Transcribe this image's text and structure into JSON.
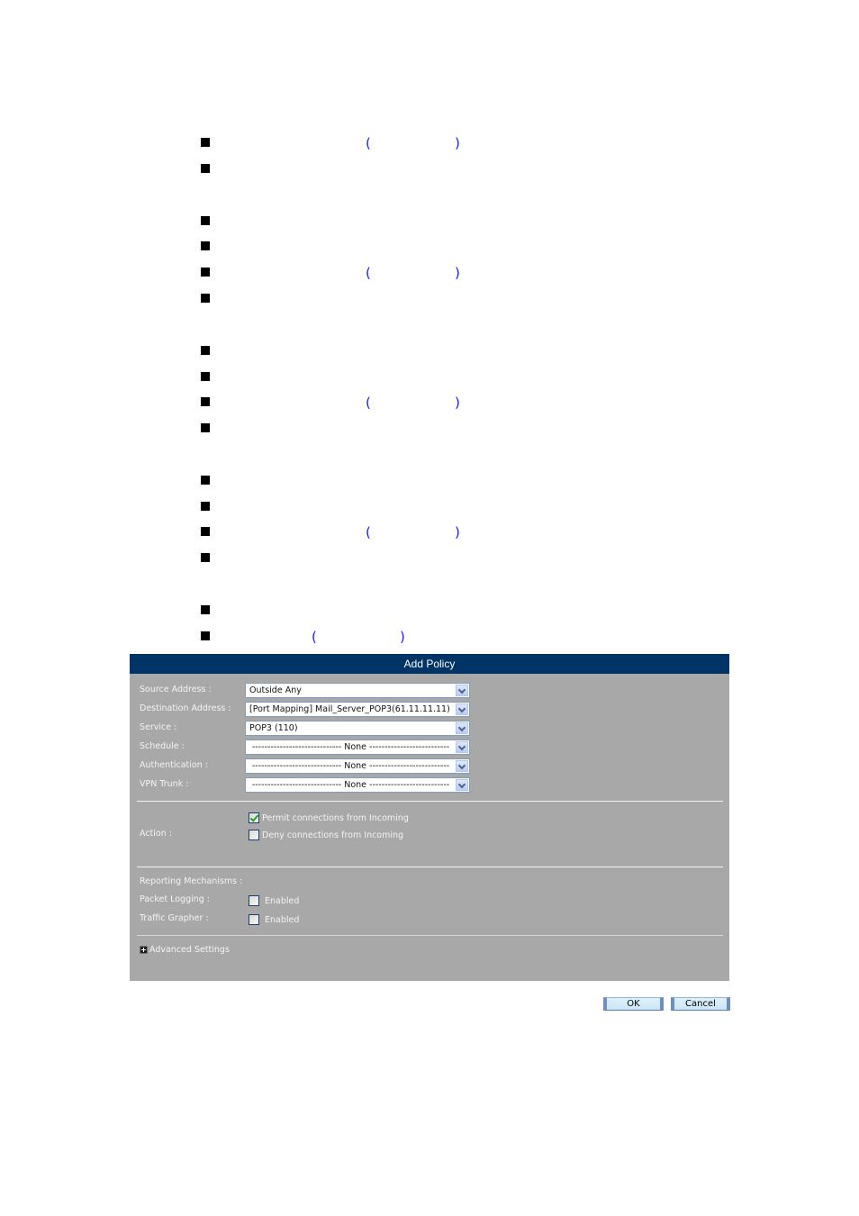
{
  "document": {
    "bullets": [
      {
        "has_parens": true
      },
      {
        "has_parens": false
      },
      {
        "has_parens": false
      },
      {
        "has_parens": false
      },
      {
        "has_parens": true
      },
      {
        "has_parens": false
      },
      {
        "has_parens": false
      },
      {
        "has_parens": false
      },
      {
        "has_parens": true
      },
      {
        "has_parens": false
      },
      {
        "has_parens": false
      },
      {
        "has_parens": false
      },
      {
        "has_parens": true
      },
      {
        "has_parens": false
      },
      {
        "has_parens": false
      },
      {
        "has_parens": true
      }
    ],
    "open_paren": "(",
    "close_paren": ")",
    "paren_color": "#1a1aff"
  },
  "panel": {
    "title": "Add Policy",
    "header_color": "#003366",
    "body_color": "#a8a8a8",
    "fields": [
      {
        "label": "Source Address :",
        "value": "Outside Any"
      },
      {
        "label": "Destination Address :",
        "value": "[Port Mapping] Mail_Server_POP3(61.11.11.11)"
      },
      {
        "label": "Service :",
        "value": "POP3 (110)"
      },
      {
        "label": "Schedule :",
        "value": "----------------------------- None --------------------------"
      },
      {
        "label": "Authentication :",
        "value": "----------------------------- None --------------------------"
      },
      {
        "label": "VPN Trunk :",
        "value": "----------------------------- None --------------------------"
      }
    ],
    "action": {
      "label": "Action :",
      "options": [
        {
          "label": "Permit connections from Incoming",
          "checked": true
        },
        {
          "label": "Deny connections from Incoming",
          "checked": false
        }
      ]
    },
    "reporting": {
      "heading": "Reporting Mechanisms :",
      "items": [
        {
          "label": "Packet Logging :",
          "option": "Enabled",
          "checked": false
        },
        {
          "label": "Traffic Grapher :",
          "option": "Enabled",
          "checked": false
        }
      ]
    },
    "advanced_settings": "Advanced Settings"
  },
  "buttons": {
    "ok": "OK",
    "cancel": "Cancel"
  }
}
